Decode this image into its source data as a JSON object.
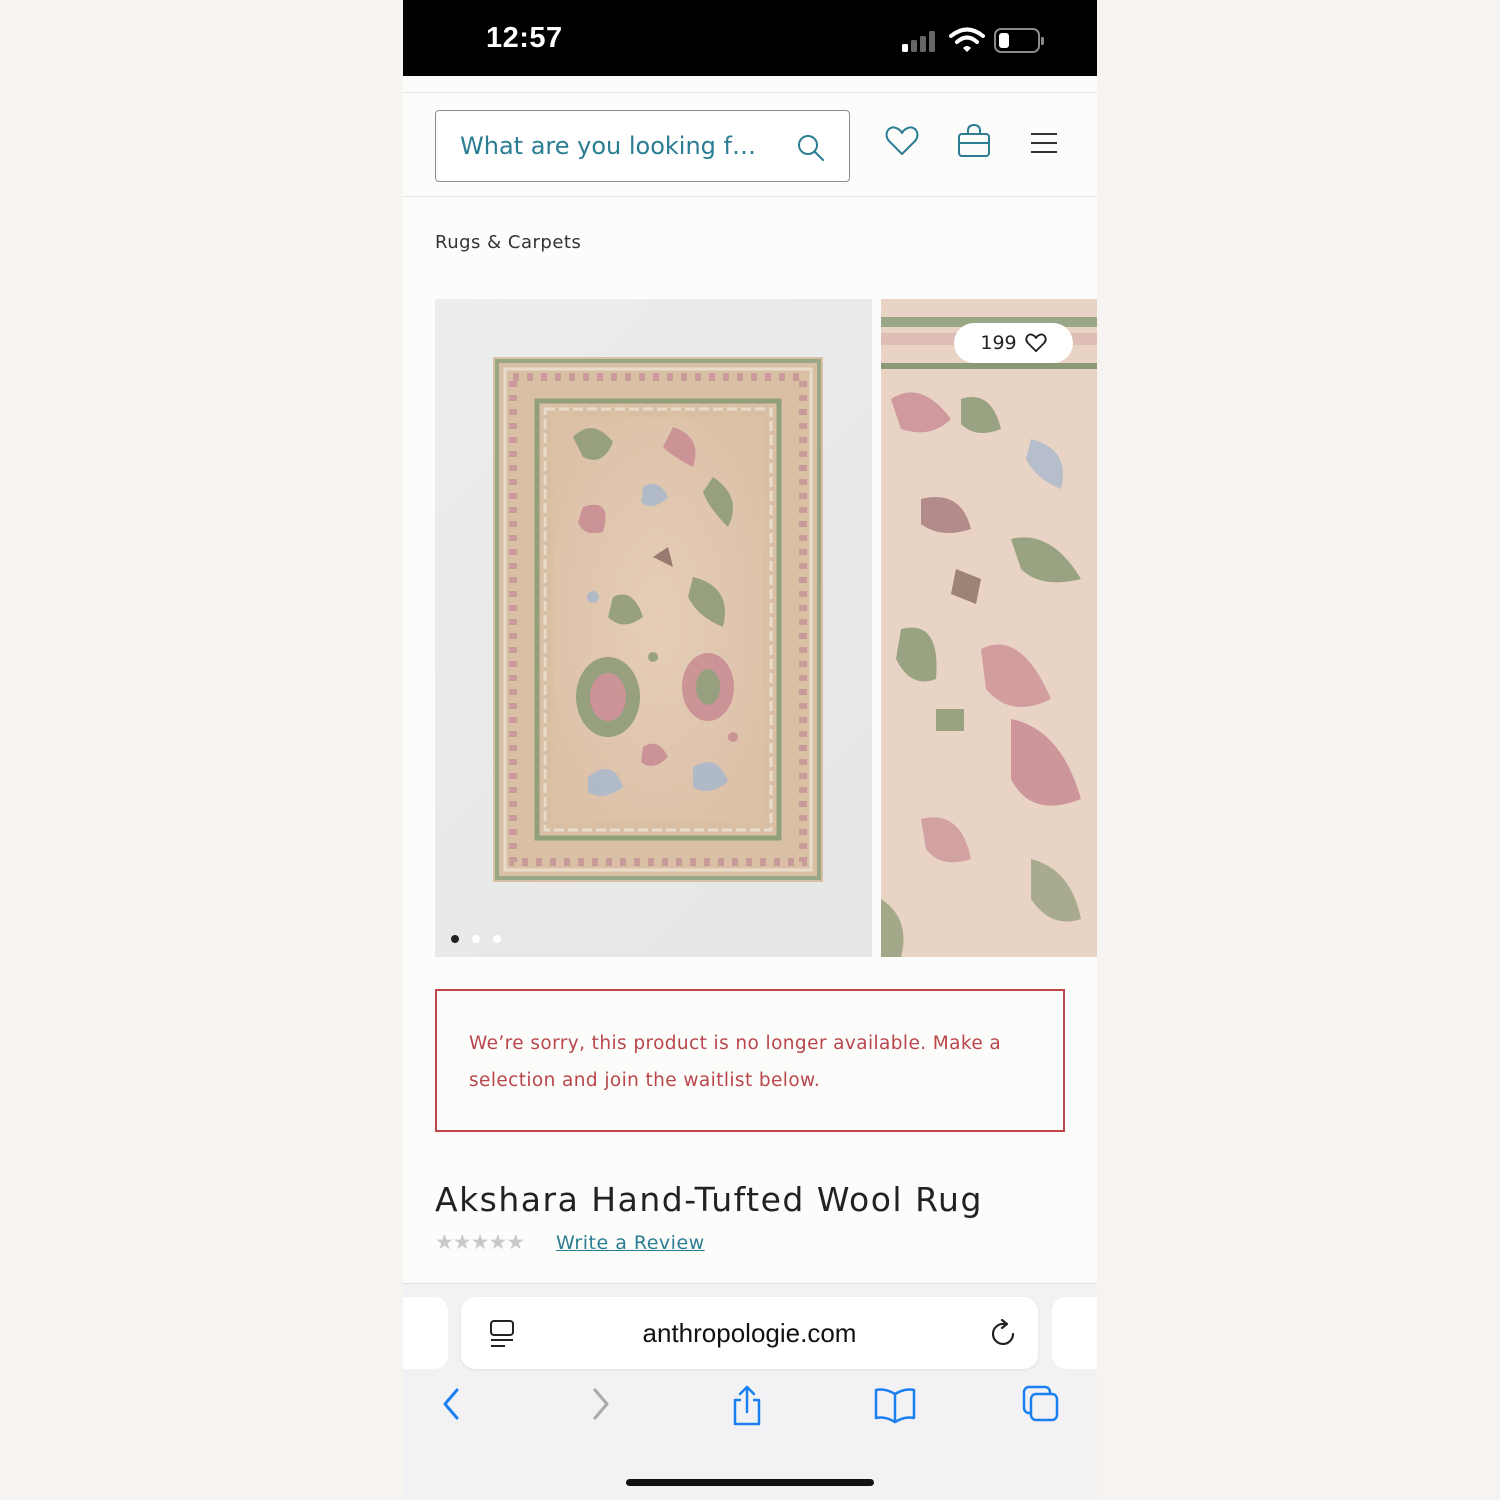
{
  "status_bar": {
    "time": "12:57"
  },
  "header": {
    "search_placeholder": "What are you looking f…",
    "icons": [
      "search-icon",
      "heart-icon",
      "bag-icon",
      "menu-icon"
    ]
  },
  "breadcrumb": "Rugs & Carpets",
  "gallery": {
    "likes": "199",
    "slides": 3,
    "active_slide": 1
  },
  "notice": {
    "text": "We’re sorry, this product is no longer available. Make a selection and join the waitlist below."
  },
  "product": {
    "title": "Akshara Hand-Tufted Wool Rug",
    "rating_stars": "★★★★★",
    "review_link": "Write a Review"
  },
  "browser": {
    "url": "anthropologie.com"
  },
  "colors": {
    "accent": "#2b7d93",
    "alert": "#b8464b",
    "ios_blue": "#1a7ff0"
  }
}
